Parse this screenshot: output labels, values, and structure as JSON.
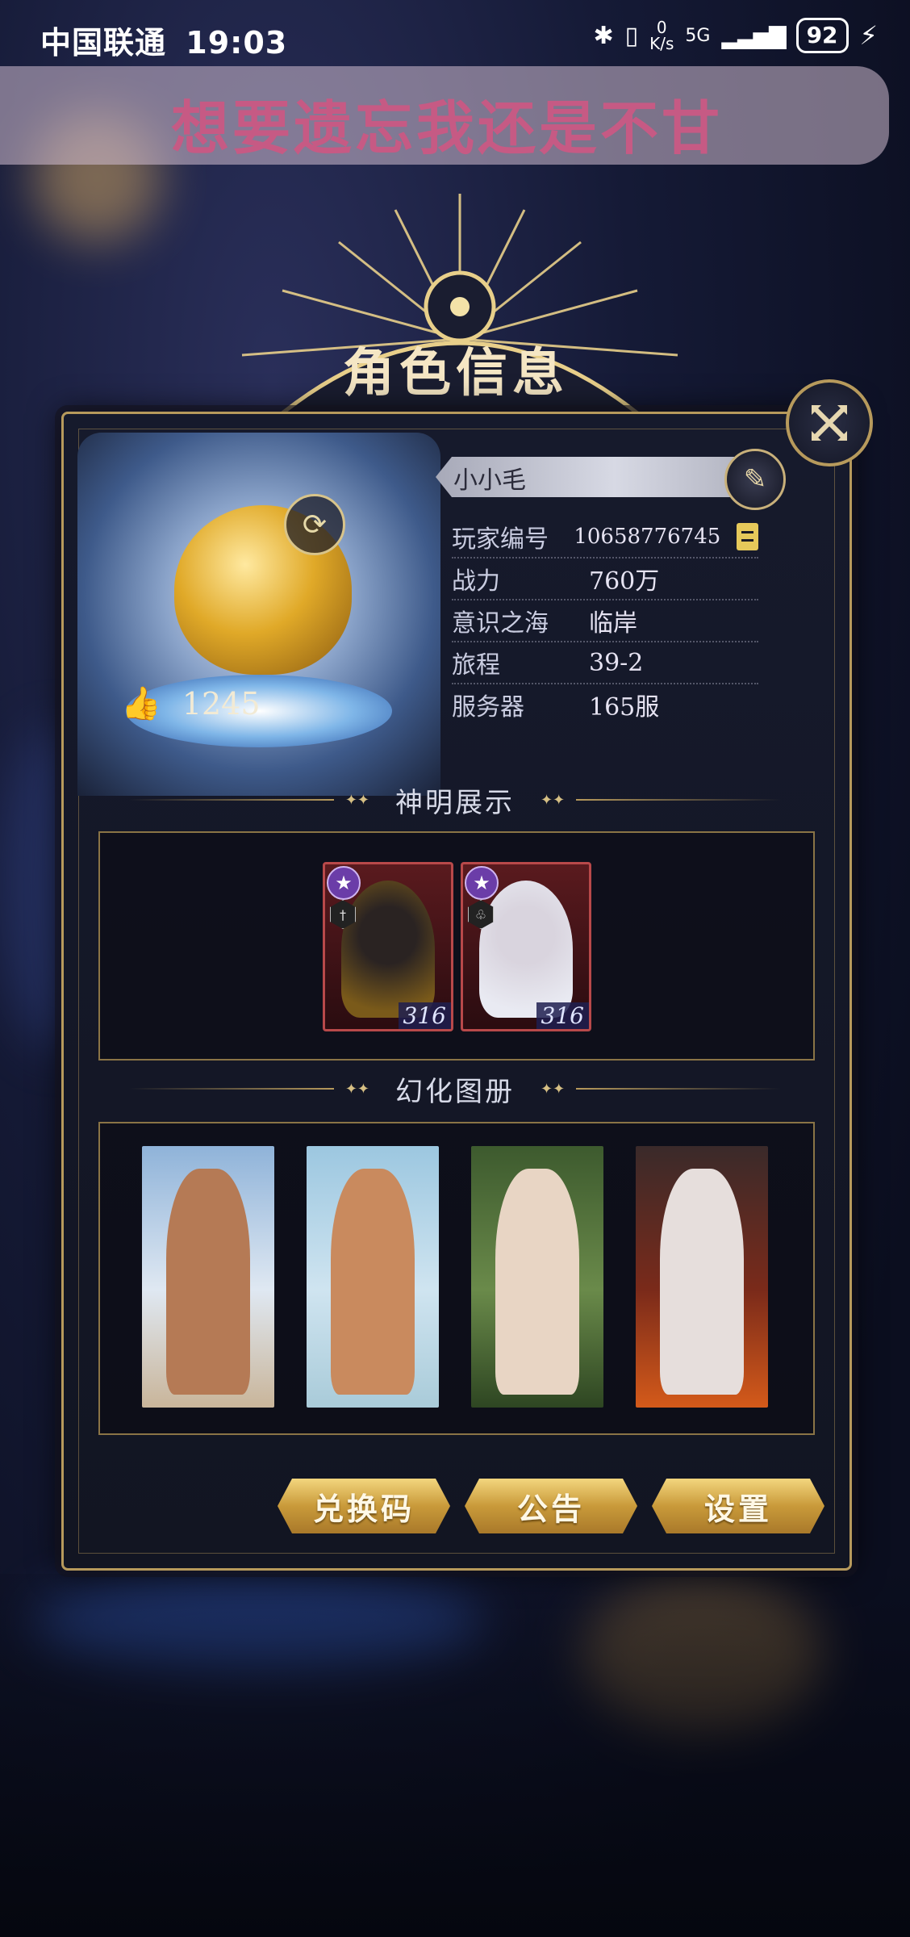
{
  "status_bar": {
    "carrier": "中国联通",
    "time": "19:03",
    "net_speed_value": "0",
    "net_speed_unit": "K/s",
    "network": "5G",
    "battery": "92"
  },
  "banner": {
    "text": "想要遗忘我还是不甘"
  },
  "panel": {
    "title": "角色信息",
    "player_name": "小小毛",
    "likes": "1245",
    "info": [
      {
        "label": "玩家编号",
        "value": "10658776745"
      },
      {
        "label": "战力",
        "value": "760万"
      },
      {
        "label": "意识之海",
        "value": "临岸"
      },
      {
        "label": "旅程",
        "value": "39-2"
      },
      {
        "label": "服务器",
        "value": "165服"
      }
    ]
  },
  "gods_section": {
    "title": "神明展示",
    "cards": [
      {
        "level": "316",
        "face_color": "#2a2322",
        "hair_color": "#7a5a1a"
      },
      {
        "level": "316",
        "face_color": "#d9d4de",
        "hair_color": "#e9eaf2"
      }
    ]
  },
  "skins_section": {
    "title": "幻化图册",
    "cards": [
      {
        "bg": "#8fb3d9",
        "figure": "#b57a55"
      },
      {
        "bg": "#9cc7e0",
        "figure": "#c98a5e"
      },
      {
        "bg": "#3d5a2e",
        "figure": "#e8d5c4"
      },
      {
        "bg": "#7a2a1a",
        "figure": "#e6dedc"
      }
    ]
  },
  "buttons": {
    "redeem": "兑换码",
    "notice": "公告",
    "settings": "设置"
  },
  "colors": {
    "gold": "#b79a5c",
    "banner_text": "#c65a84"
  }
}
